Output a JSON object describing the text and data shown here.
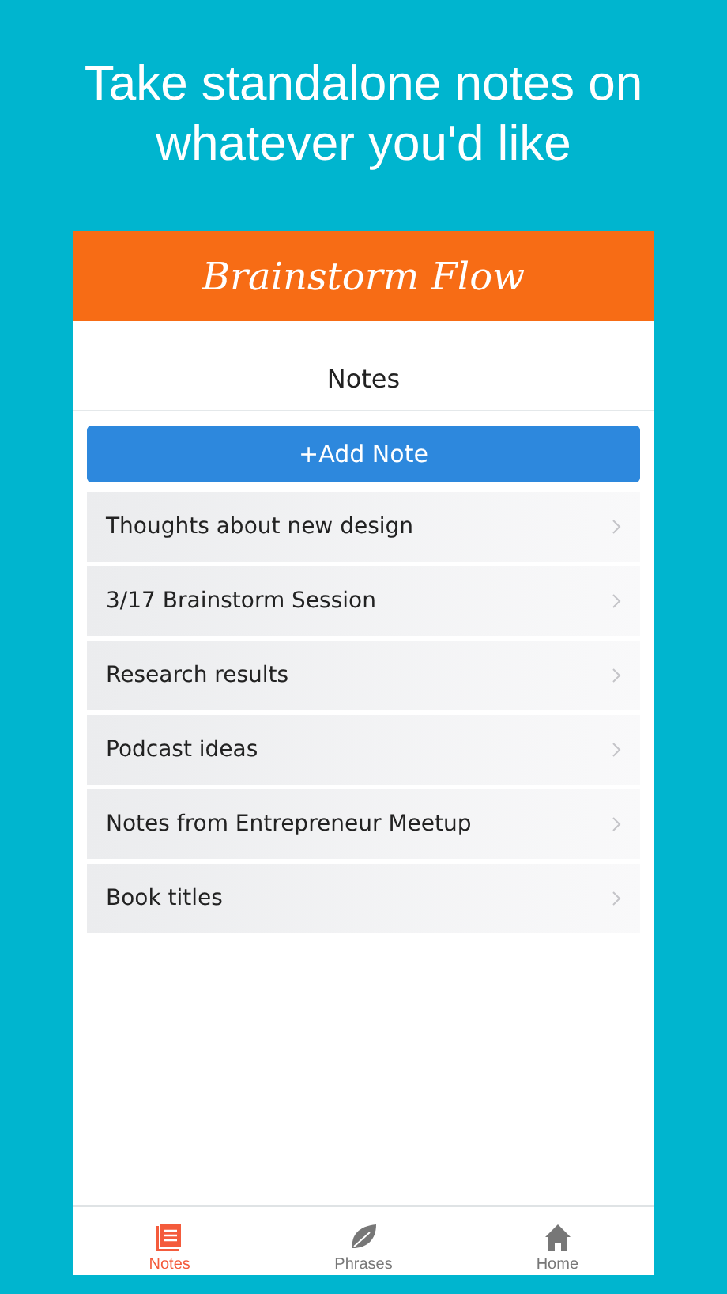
{
  "headline": "Take standalone notes on whatever you'd like",
  "app": {
    "title": "Brainstorm Flow",
    "section_title": "Notes",
    "add_button": "+Add Note",
    "notes": [
      {
        "title": "Thoughts about new design"
      },
      {
        "title": "3/17 Brainstorm Session"
      },
      {
        "title": "Research results"
      },
      {
        "title": "Podcast ideas"
      },
      {
        "title": "Notes from Entrepreneur Meetup"
      },
      {
        "title": "Book titles"
      }
    ],
    "tabs": [
      {
        "label": "Notes",
        "kind": "notes",
        "selected": true
      },
      {
        "label": "Phrases",
        "kind": "leaf",
        "selected": false
      },
      {
        "label": "Home",
        "kind": "home",
        "selected": false
      }
    ]
  }
}
